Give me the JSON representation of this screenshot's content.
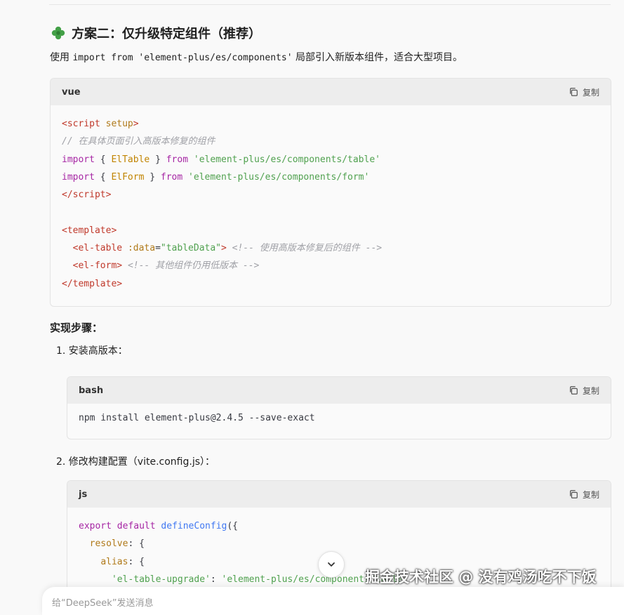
{
  "heading": {
    "emoji_icon": "clover-icon",
    "text": "方案二：仅升级特定组件（推荐）"
  },
  "intro": {
    "pre": "使用 ",
    "code": "import from 'element-plus/es/components'",
    "post": " 局部引入新版本组件，适合大型项目。"
  },
  "copy_label": "复制",
  "block1": {
    "lang": "vue",
    "lines": [
      [
        [
          "tag",
          "<"
        ],
        [
          "tag",
          "script"
        ],
        [
          "plain",
          " "
        ],
        [
          "attr",
          "setup"
        ],
        [
          "tag",
          ">"
        ]
      ],
      [
        [
          "cm",
          "// 在具体页面引入高版本修复的组件"
        ]
      ],
      [
        [
          "kw",
          "import"
        ],
        [
          "plain",
          " { "
        ],
        [
          "id",
          "ElTable"
        ],
        [
          "plain",
          " } "
        ],
        [
          "kw",
          "from"
        ],
        [
          "plain",
          " "
        ],
        [
          "str",
          "'element-plus/es/components/table'"
        ]
      ],
      [
        [
          "kw",
          "import"
        ],
        [
          "plain",
          " { "
        ],
        [
          "id",
          "ElForm"
        ],
        [
          "plain",
          " } "
        ],
        [
          "kw",
          "from"
        ],
        [
          "plain",
          " "
        ],
        [
          "str",
          "'element-plus/es/components/form'"
        ]
      ],
      [
        [
          "tag",
          "</"
        ],
        [
          "tag",
          "script"
        ],
        [
          "tag",
          ">"
        ]
      ],
      [
        [
          "plain",
          ""
        ]
      ],
      [
        [
          "tag",
          "<"
        ],
        [
          "tag",
          "template"
        ],
        [
          "tag",
          ">"
        ]
      ],
      [
        [
          "plain",
          "  "
        ],
        [
          "tag",
          "<"
        ],
        [
          "tag",
          "el-table"
        ],
        [
          "plain",
          " "
        ],
        [
          "attr",
          ":data"
        ],
        [
          "plain",
          "="
        ],
        [
          "str",
          "\"tableData\""
        ],
        [
          "tag",
          ">"
        ],
        [
          "plain",
          " "
        ],
        [
          "cm",
          "<!-- 使用高版本修复后的组件 -->"
        ]
      ],
      [
        [
          "plain",
          "  "
        ],
        [
          "tag",
          "<"
        ],
        [
          "tag",
          "el-form"
        ],
        [
          "tag",
          ">"
        ],
        [
          "plain",
          " "
        ],
        [
          "cm",
          "<!-- 其他组件仍用低版本 -->"
        ]
      ],
      [
        [
          "tag",
          "</"
        ],
        [
          "tag",
          "template"
        ],
        [
          "tag",
          ">"
        ]
      ]
    ]
  },
  "steps_heading": "实现步骤：",
  "step1": "1. 安装高版本：",
  "block2": {
    "lang": "bash",
    "lines": [
      [
        [
          "plain",
          "npm install element-plus@2.4.5 --save-exact"
        ]
      ]
    ]
  },
  "step2": "2. 修改构建配置（vite.config.js）：",
  "block3": {
    "lang": "js",
    "lines": [
      [
        [
          "kw",
          "export"
        ],
        [
          "plain",
          " "
        ],
        [
          "kw",
          "default"
        ],
        [
          "plain",
          " "
        ],
        [
          "fn",
          "defineConfig"
        ],
        [
          "plain",
          "({"
        ]
      ],
      [
        [
          "plain",
          "  "
        ],
        [
          "attr",
          "resolve"
        ],
        [
          "plain",
          ": {"
        ]
      ],
      [
        [
          "plain",
          "    "
        ],
        [
          "attr",
          "alias"
        ],
        [
          "plain",
          ": {"
        ]
      ],
      [
        [
          "plain",
          "      "
        ],
        [
          "str",
          "'el-table-upgrade'"
        ],
        [
          "plain",
          ": "
        ],
        [
          "str",
          "'element-plus/es/components/table'"
        ]
      ]
    ]
  },
  "watermark": "掘金技术社区 @ 没有鸡汤吃不下饭",
  "bottom_hint": "给“DeepSeek”发送消息"
}
